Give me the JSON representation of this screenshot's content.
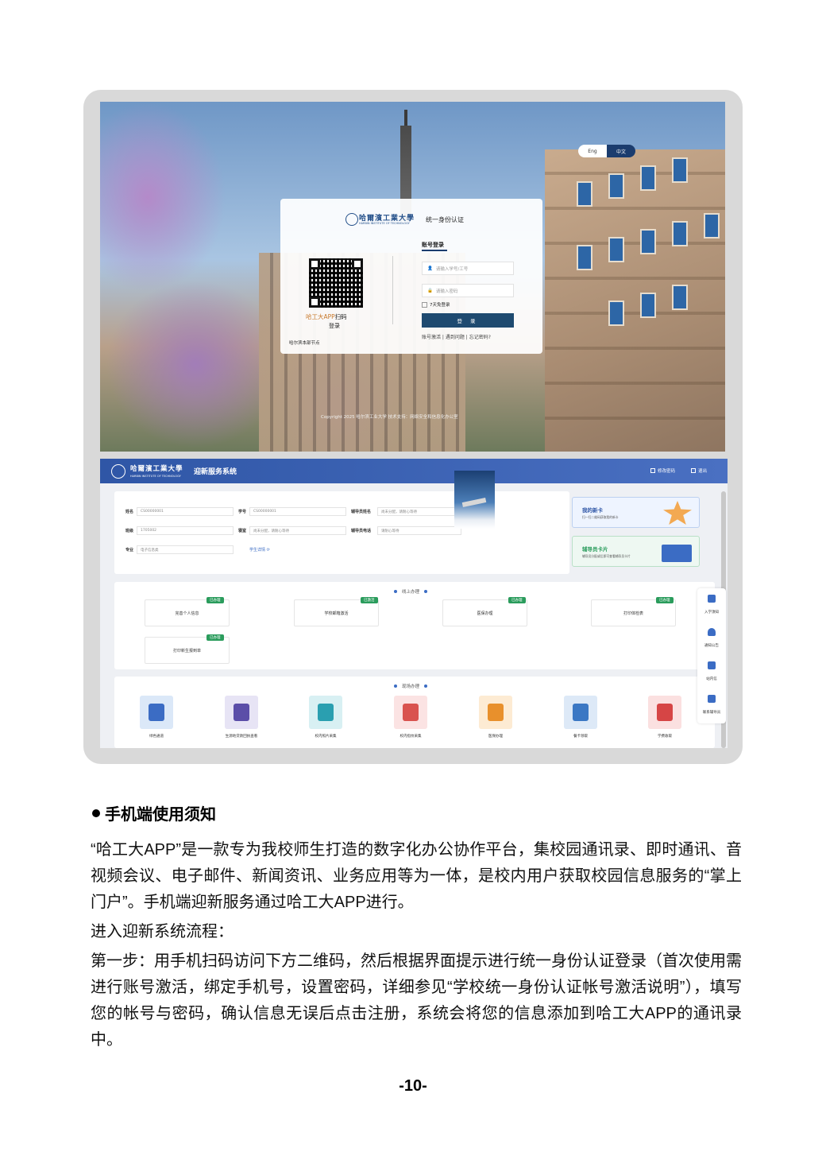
{
  "login": {
    "lang_en": "Eng",
    "lang_zh": "中文",
    "university": "哈爾濱工業大學",
    "university_en": "HARBIN INSTITUTE OF TECHNOLOGY",
    "title": "统一身份认证",
    "qr_text_app": "哈工大APP",
    "qr_text_scan": "扫码",
    "qr_text_login": "登录",
    "node": "哈尔滨本部节点",
    "tab": "账号登录",
    "username_placeholder": "请输入学号/工号",
    "password_placeholder": "请输入密码",
    "remember": "7天免登录",
    "login_button": "登 录",
    "link_activate": "账号激活",
    "link_problem": "遇到问题",
    "link_forgot": "忘记密码?",
    "copyright": "Copyright 2025 哈尔滨工业大学 技术支持：网络安全和信息化办公室"
  },
  "portal": {
    "university": "哈爾濱工業大學",
    "university_en": "HARBIN INSTITUTE OF TECHNOLOGY",
    "system_title": "迎新服务系统",
    "change_password": "修改密码",
    "logout": "退出",
    "info": {
      "name_label": "姓名",
      "name_value": "CS00000001",
      "id_label": "学号",
      "id_value": "CS00000001",
      "counselor_label": "辅导员姓名",
      "counselor_value": "尚未分配，请耐心等待",
      "class_label": "班级",
      "class_value": "1705002",
      "dorm_label": "寝室",
      "dorm_value": "尚未分配，请耐心等待",
      "phone_label": "辅导员电话",
      "phone_value": "请耐心等待",
      "major_label": "专业",
      "major_value": "电子信息类",
      "detail_link": "学生详情"
    },
    "promo_card": {
      "title": "我的新卡",
      "sub": "扫一扫二维码获取我的新卡"
    },
    "promo_counselor": {
      "title": "辅导员卡片",
      "sub": "辅导员分配或后即可查看辅导员卡片"
    },
    "online": {
      "title": "线上办理",
      "items": [
        {
          "label": "完善个人信息",
          "tag": "已办理"
        },
        {
          "label": "学校邮箱激活",
          "tag": "已激活"
        },
        {
          "label": "医保办理",
          "tag": "已办理"
        },
        {
          "label": "打印体检表",
          "tag": "已办理"
        },
        {
          "label": "打印新生报到单",
          "tag": "已办理"
        }
      ]
    },
    "onsite": {
      "title": "现场办理",
      "items": [
        {
          "label": "绿色通道",
          "bg": "#dbe8f8",
          "fg": "#3b6cc4"
        },
        {
          "label": "生源地贷款回执查看",
          "bg": "#e7e4f5",
          "fg": "#5b4ea8"
        },
        {
          "label": "校内照片采集",
          "bg": "#d8f0f3",
          "fg": "#2a9fb0"
        },
        {
          "label": "校内指纹采集",
          "bg": "#fbe3e3",
          "fg": "#d9534f"
        },
        {
          "label": "医保办理",
          "bg": "#fdebd3",
          "fg": "#e8902c"
        },
        {
          "label": "餐卡领取",
          "bg": "#dde9f7",
          "fg": "#3b78c4"
        },
        {
          "label": "学费收取",
          "bg": "#fbe0e0",
          "fg": "#d64545"
        }
      ]
    },
    "quick_links": [
      "入学须知",
      "通知公告",
      "站内信",
      "联系辅导员"
    ]
  },
  "body": {
    "heading": "手机端使用须知",
    "para1": "“哈工大APP”是一款专为我校师生打造的数字化办公协作平台，集校园通讯录、即时通讯、音视频会议、电子邮件、新闻资讯、业务应用等为一体，是校内用户获取校园信息服务的“掌上门户”。手机端迎新服务通过哈工大APP进行。",
    "para2": "进入迎新系统流程：",
    "para3": "第一步：用手机扫码访问下方二维码，然后根据界面提示进行统一身份认证登录（首次使用需进行账号激活，绑定手机号，设置密码，详细参见“学校统一身份认证帐号激活说明”），填写您的帐号与密码，确认信息无误后点击注册，系统会将您的信息添加到哈工大APP的通讯录中。",
    "page_number": "-10-"
  }
}
